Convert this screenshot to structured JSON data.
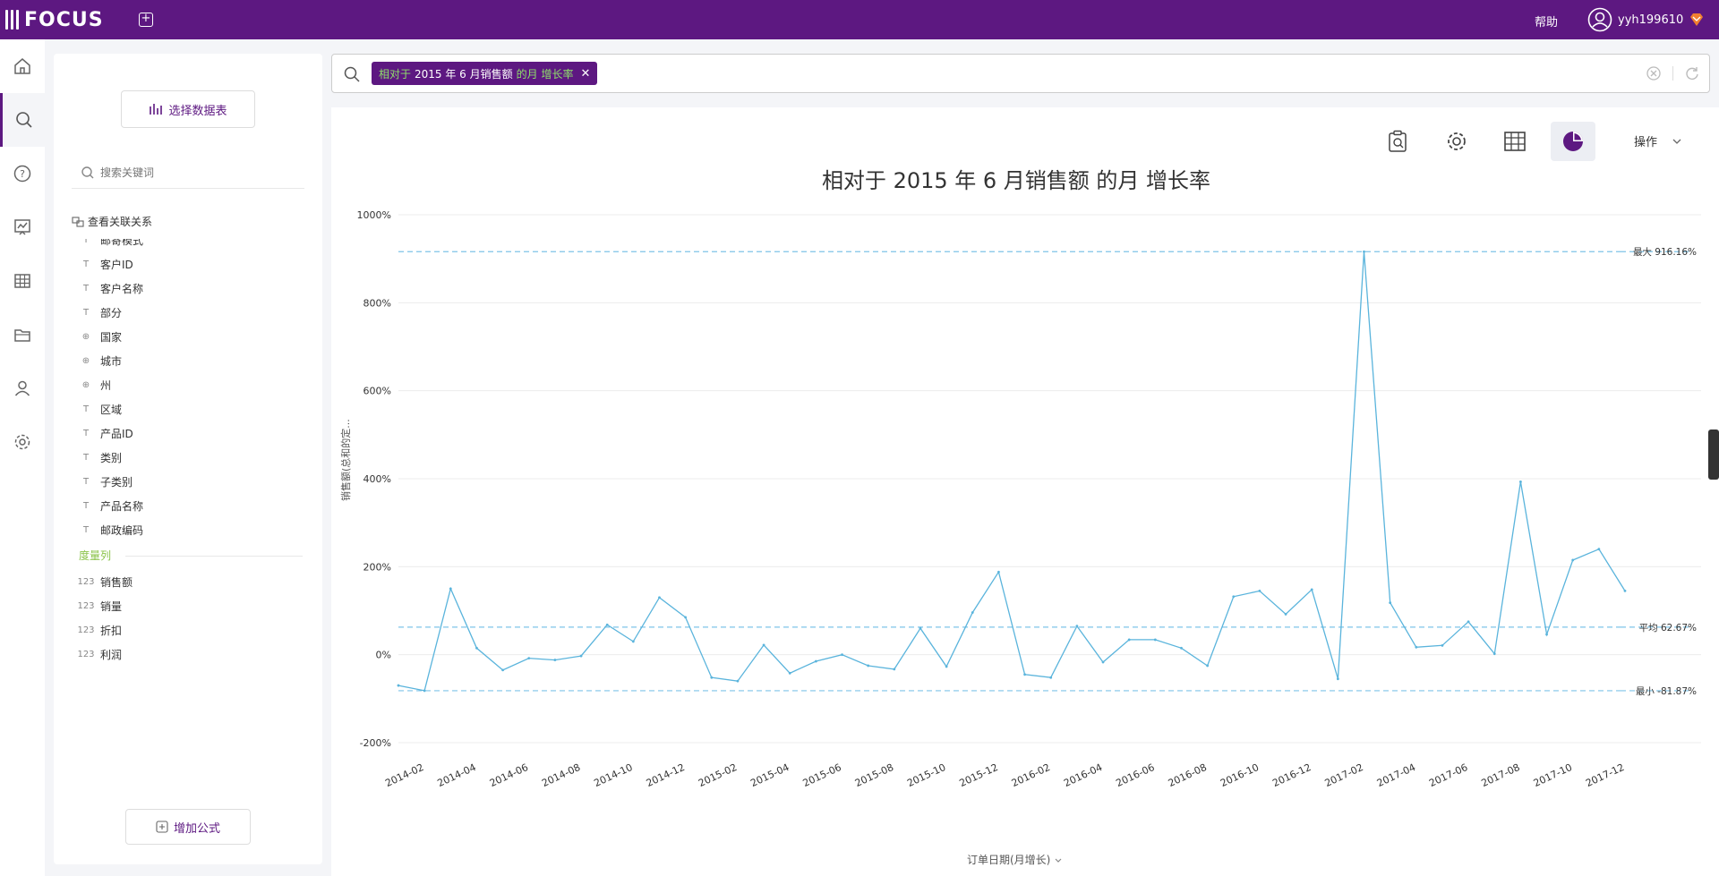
{
  "app": {
    "logo_text": "FOCUS",
    "help_label": "帮助",
    "username": "yyh199610",
    "accent_color": "#5d1881"
  },
  "nav": {
    "items": [
      {
        "icon": "home-icon"
      },
      {
        "icon": "search-icon"
      },
      {
        "icon": "help-icon"
      },
      {
        "icon": "dashboard-icon"
      },
      {
        "icon": "table-icon"
      },
      {
        "icon": "folder-icon"
      },
      {
        "icon": "user-icon"
      },
      {
        "icon": "settings-icon"
      }
    ]
  },
  "sidebar": {
    "select_datasource_label": "选择数据表",
    "search_placeholder": "搜索关键词",
    "relation_label": "查看关联关系",
    "partial_field_label": "邮寄模式",
    "fields": [
      {
        "type": "text",
        "label": "客户ID"
      },
      {
        "type": "text",
        "label": "客户名称"
      },
      {
        "type": "text",
        "label": "部分"
      },
      {
        "type": "geo",
        "label": "国家"
      },
      {
        "type": "geo",
        "label": "城市"
      },
      {
        "type": "geo",
        "label": "州"
      },
      {
        "type": "text",
        "label": "区域"
      },
      {
        "type": "text",
        "label": "产品ID"
      },
      {
        "type": "text",
        "label": "类别"
      },
      {
        "type": "text",
        "label": "子类别"
      },
      {
        "type": "text",
        "label": "产品名称"
      },
      {
        "type": "text",
        "label": "邮政编码"
      }
    ],
    "measure_title": "度量列",
    "measures": [
      {
        "type": "123",
        "label": "销售额"
      },
      {
        "type": "123",
        "label": "销量"
      },
      {
        "type": "123",
        "label": "折扣"
      },
      {
        "type": "123",
        "label": "利润"
      }
    ],
    "add_formula_label": "增加公式"
  },
  "search": {
    "token_prefix": "相对于",
    "token_mid": "2015 年 6 月销售额",
    "token_suffix": "的月 增长率"
  },
  "toolbar": {
    "ops_label": "操作"
  },
  "chart_data": {
    "type": "line",
    "title": "相对于 2015 年 6 月销售额 的月 增长率",
    "xlabel": "订单日期(月增长)",
    "ylabel": "销售额(总和的定...",
    "ylim": [
      -200,
      1000
    ],
    "yticks": [
      "1000%",
      "800%",
      "600%",
      "400%",
      "200%",
      "0%",
      "-200%"
    ],
    "x_tick_labels": [
      "2014-02",
      "2014-04",
      "2014-06",
      "2014-08",
      "2014-10",
      "2014-12",
      "2015-02",
      "2015-04",
      "2015-06",
      "2015-08",
      "2015-10",
      "2015-12",
      "2016-02",
      "2016-04",
      "2016-06",
      "2016-08",
      "2016-10",
      "2016-12",
      "2017-02",
      "2017-04",
      "2017-06",
      "2017-08",
      "2017-10",
      "2017-12"
    ],
    "x": [
      "2014-01",
      "2014-02",
      "2014-03",
      "2014-04",
      "2014-05",
      "2014-06",
      "2014-07",
      "2014-08",
      "2014-09",
      "2014-10",
      "2014-11",
      "2014-12",
      "2015-01",
      "2015-02",
      "2015-03",
      "2015-04",
      "2015-05",
      "2015-06",
      "2015-07",
      "2015-08",
      "2015-09",
      "2015-10",
      "2015-11",
      "2015-12",
      "2016-01",
      "2016-02",
      "2016-03",
      "2016-04",
      "2016-05",
      "2016-06",
      "2016-07",
      "2016-08",
      "2016-09",
      "2016-10",
      "2016-11",
      "2016-12",
      "2017-01",
      "2017-02",
      "2017-03",
      "2017-04",
      "2017-05",
      "2017-06",
      "2017-07",
      "2017-08",
      "2017-09",
      "2017-10",
      "2017-11",
      "2017-12"
    ],
    "values": [
      -70,
      -81.87,
      150,
      15,
      -35,
      -8,
      -12,
      -3,
      68,
      30,
      130,
      85,
      -52,
      -60,
      22,
      -42,
      -15,
      0,
      -25,
      -33,
      60,
      -27,
      96,
      188,
      -45,
      -52,
      65,
      -17,
      34,
      34,
      15,
      -25,
      132,
      145,
      92,
      148,
      -55,
      916.16,
      118,
      17,
      21,
      75,
      2,
      393,
      46,
      215,
      240,
      145
    ],
    "reference_lines": [
      {
        "label": "最大 916.16%",
        "value": 916.16
      },
      {
        "label": "平均 62.67%",
        "value": 62.67
      },
      {
        "label": "最小 -81.87%",
        "value": -81.87
      }
    ],
    "line_color": "#5ab4dc",
    "ref_line_color": "#7fc4e8",
    "grid": true
  }
}
